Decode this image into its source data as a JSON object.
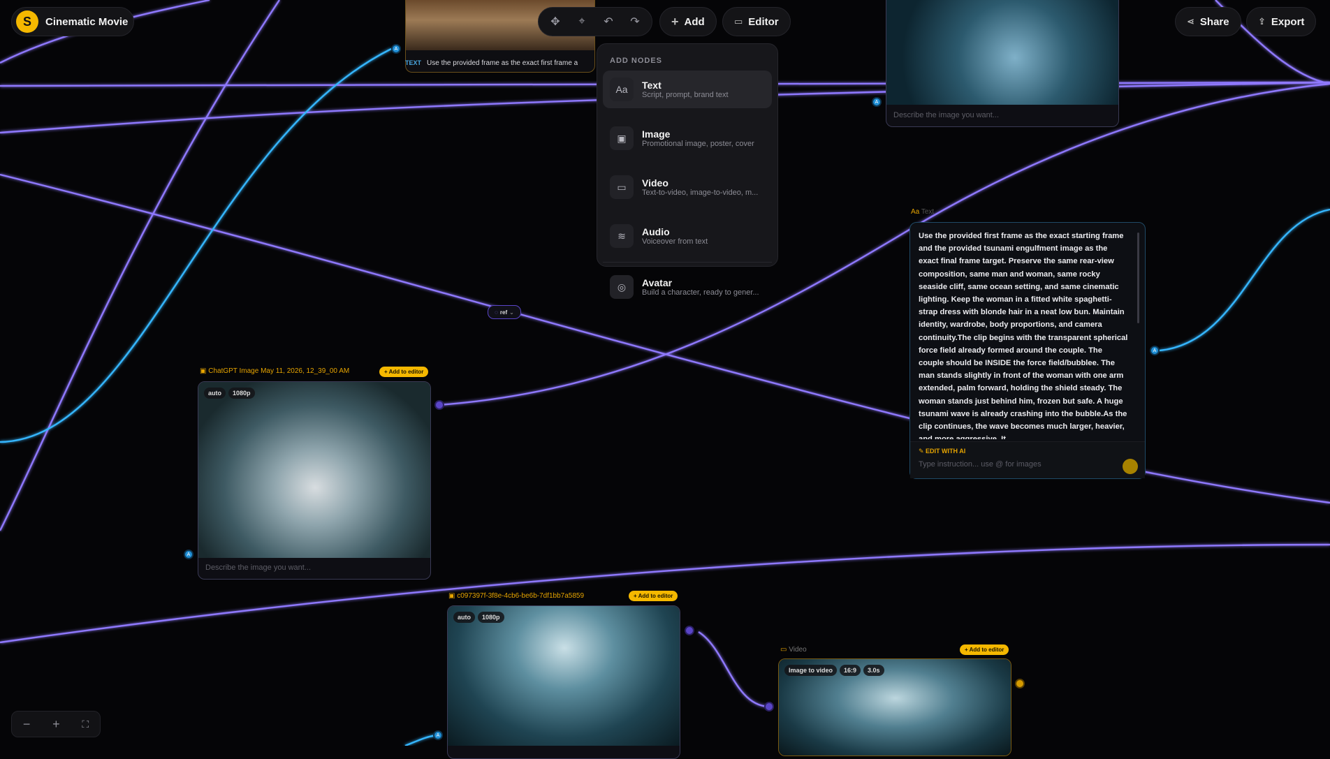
{
  "app": {
    "project_title": "Cinematic Movie",
    "logo_glyph": "S",
    "brand_color": "#f5b800"
  },
  "toolbar": {
    "add_label": "Add",
    "editor_label": "Editor",
    "share_label": "Share",
    "export_label": "Export",
    "tools": [
      "select-tool-icon",
      "lasso-tool-icon",
      "undo-icon",
      "redo-icon"
    ]
  },
  "add_menu": {
    "header": "ADD NODES",
    "items": [
      {
        "label": "Text",
        "desc": "Script, prompt, brand text",
        "icon": "Aa"
      },
      {
        "label": "Image",
        "desc": "Promotional image, poster, cover",
        "icon": "▣"
      },
      {
        "label": "Video",
        "desc": "Text-to-video, image-to-video, m...",
        "icon": "▭"
      },
      {
        "label": "Audio",
        "desc": "Voiceover from text",
        "icon": "≋"
      },
      {
        "label": "Avatar",
        "desc": "Build a character, ready to gener...",
        "icon": "◎"
      }
    ]
  },
  "top_text_node": {
    "badge": "TEXT",
    "snippet": "Use the provided frame as the exact first frame a"
  },
  "top_right_image_node": {
    "prompt_placeholder": "Describe the image you want..."
  },
  "ref_chip": {
    "label": "ref"
  },
  "image_node_tsunami": {
    "label": "ChatGPT Image May 11, 2026, 12_39_00 AM",
    "add_label": "+ Add to editor",
    "chips": [
      "auto",
      "1080p"
    ],
    "prompt_placeholder": "Describe the image you want..."
  },
  "image_node_couple": {
    "label": "c097397f-3f8e-4cb6-be6b-7df1bb7a5859",
    "add_label": "+ Add to editor",
    "chips": [
      "auto",
      "1080p"
    ]
  },
  "video_node": {
    "label": "Video",
    "add_label": "+ Add to editor",
    "chips": [
      "Image to video",
      "16:9",
      "3.0s"
    ]
  },
  "text_node": {
    "label": "Text",
    "body": "Use the provided first frame as the exact starting frame and the provided tsunami engulfment image as the exact final frame target. Preserve the same rear-view composition, same man and woman, same rocky seaside cliff, same ocean setting, and same cinematic lighting. Keep the woman in a fitted white spaghetti-strap dress with blonde hair in a neat low bun. Maintain identity, wardrobe, body proportions, and camera continuity.The clip begins with the transparent spherical force field already formed around the couple. The couple should be INSIDE the force field/bubblee. The man stands slightly in front of the woman with one arm extended, palm forward, holding the shield steady. The woman stands just behind him, frozen but safe. A huge tsunami wave is already crashing into the bubble.As the clip continues, the wave becomes much larger, heavier, and more aggressive. It",
    "edit_with_ai": "EDIT WITH AI",
    "instruction_placeholder": "Type instruction... use @ for images"
  },
  "zoom": {
    "minus": "−",
    "plus": "+",
    "fit": "⛶"
  }
}
